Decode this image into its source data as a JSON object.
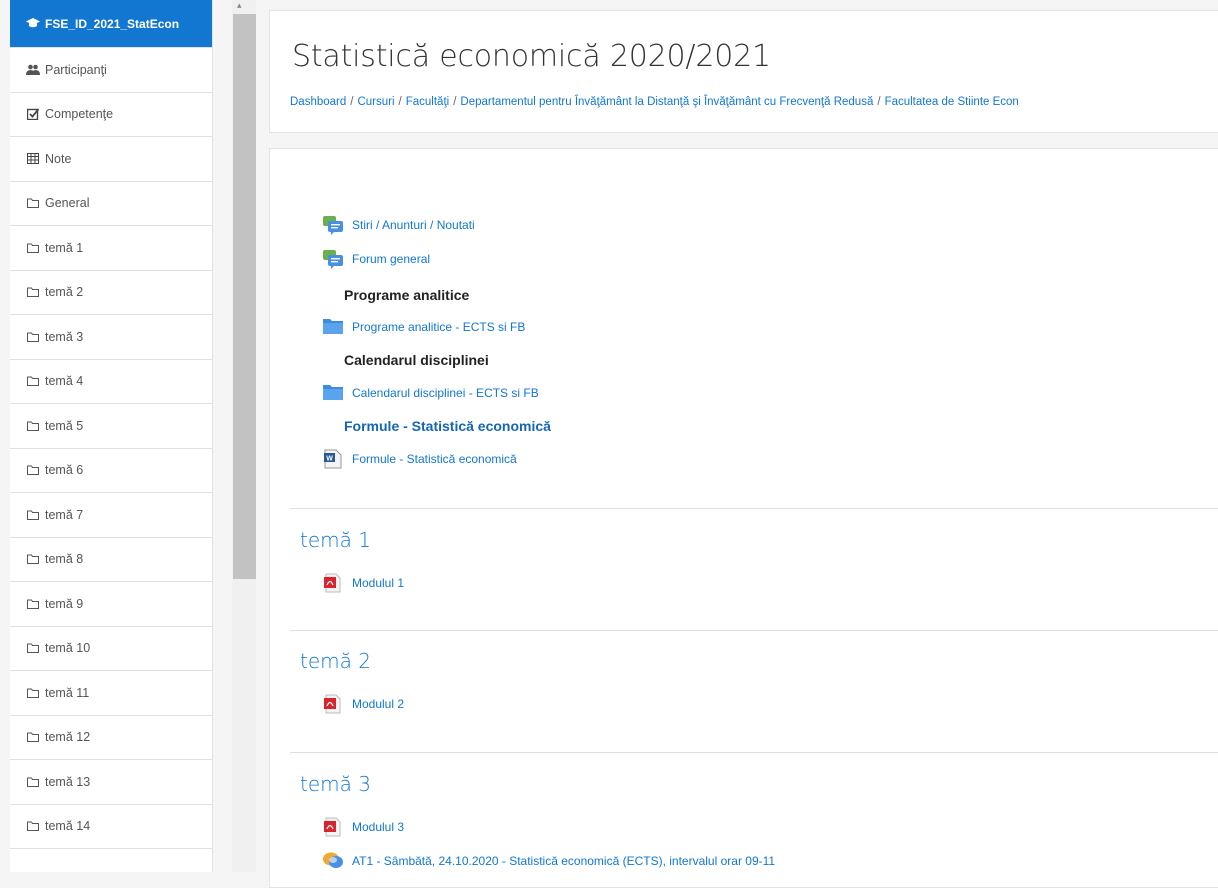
{
  "sidebar": {
    "items": [
      {
        "label": "FSE_ID_2021_StatEcon",
        "icon": "graduation-cap-icon",
        "active": true
      },
      {
        "label": "Participanţi",
        "icon": "users-icon"
      },
      {
        "label": "Competenţe",
        "icon": "checkbox-icon"
      },
      {
        "label": "Note",
        "icon": "table-icon"
      },
      {
        "label": "General",
        "icon": "folder-icon"
      },
      {
        "label": "temă 1",
        "icon": "folder-icon"
      },
      {
        "label": "temă 2",
        "icon": "folder-icon"
      },
      {
        "label": "temă 3",
        "icon": "folder-icon"
      },
      {
        "label": "temă 4",
        "icon": "folder-icon"
      },
      {
        "label": "temă 5",
        "icon": "folder-icon"
      },
      {
        "label": "temă 6",
        "icon": "folder-icon"
      },
      {
        "label": "temă 7",
        "icon": "folder-icon"
      },
      {
        "label": "temă 8",
        "icon": "folder-icon"
      },
      {
        "label": "temă 9",
        "icon": "folder-icon"
      },
      {
        "label": "temă 10",
        "icon": "folder-icon"
      },
      {
        "label": "temă 11",
        "icon": "folder-icon"
      },
      {
        "label": "temă 12",
        "icon": "folder-icon"
      },
      {
        "label": "temă 13",
        "icon": "folder-icon"
      },
      {
        "label": "temă 14",
        "icon": "folder-icon"
      }
    ]
  },
  "header": {
    "title": "Statistică economică 2020/2021",
    "breadcrumb": [
      "Dashboard",
      "Cursuri",
      "Facultăţi",
      "Departamentul pentru Învăţământ la Distanţă şi Învăţământ cu Frecvenţă Redusă",
      "Facultatea de Stiinte Econ"
    ],
    "separator": "/"
  },
  "general": {
    "activities": [
      {
        "label": "Stiri / Anunturi / Noutati",
        "icon": "forum-icon"
      },
      {
        "label": "Forum general",
        "icon": "forum-icon"
      }
    ],
    "label_programe": "Programe analitice",
    "folder_programe": "Programe analitice - ECTS si FB",
    "label_calendar": "Calendarul disciplinei",
    "folder_calendar": "Calendarul disciplinei - ECTS si FB",
    "label_formule": "Formule - Statistică economică",
    "file_formule": "Formule - Statistică economică"
  },
  "sections": [
    {
      "title": "temă 1",
      "activities": [
        {
          "label": "Modulul 1",
          "icon": "pdf-icon"
        }
      ]
    },
    {
      "title": "temă 2",
      "activities": [
        {
          "label": "Modulul 2",
          "icon": "pdf-icon"
        }
      ]
    },
    {
      "title": "temă 3",
      "activities": [
        {
          "label": "Modulul 3",
          "icon": "pdf-icon"
        },
        {
          "label": "AT1 - Sâmbătă, 24.10.2020 - Statistică economică (ECTS), intervalul orar 09-11",
          "icon": "chat-icon"
        }
      ]
    }
  ],
  "colors": {
    "accent": "#1177d1",
    "active_bg": "#1177d1"
  }
}
